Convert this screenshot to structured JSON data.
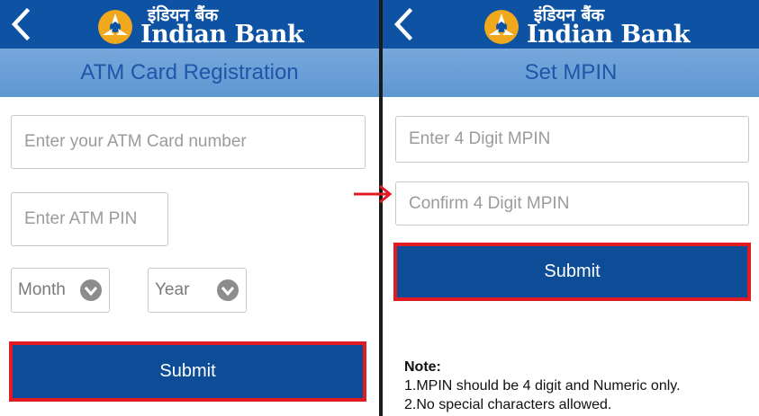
{
  "colors": {
    "header_blue": "#0d52a3",
    "subheader_blue": "#6a9fd6",
    "subheader_text": "#1f56a8",
    "button_blue": "#0d4d98",
    "highlight_red": "#e01b24",
    "logo_yellow": "#f0a81c"
  },
  "brand": {
    "hindi": "इंडियन बैंक",
    "english": "Indian Bank"
  },
  "left_screen": {
    "title": "ATM Card Registration",
    "card_number_placeholder": "Enter your ATM Card number",
    "atm_pin_placeholder": "Enter ATM PIN",
    "month_label": "Month",
    "year_label": "Year",
    "submit_label": "Submit"
  },
  "right_screen": {
    "title": "Set MPIN",
    "mpin_placeholder": "Enter 4 Digit MPIN",
    "confirm_placeholder": "Confirm 4 Digit MPIN",
    "submit_label": "Submit",
    "note_title": "Note:",
    "note_lines": [
      "1.MPIN should be 4 digit and Numeric only.",
      "2.No special characters allowed."
    ]
  },
  "icons": {
    "back": "chevron-left-icon",
    "dropdown": "chevron-down-circle-icon",
    "flow": "right-arrow-icon",
    "logo": "indian-bank-logo"
  }
}
